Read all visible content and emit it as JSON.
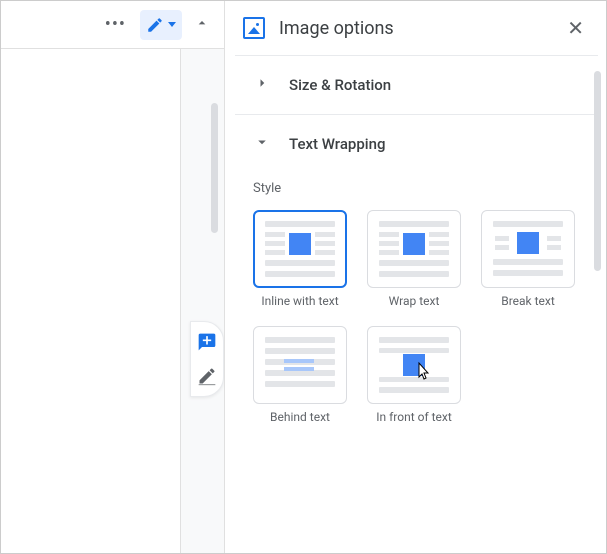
{
  "panel": {
    "title": "Image options",
    "sections": {
      "size_rotation": "Size & Rotation",
      "text_wrapping": "Text Wrapping"
    },
    "style_label": "Style",
    "wrap_options": {
      "inline": "Inline with text",
      "wrap": "Wrap text",
      "break": "Break text",
      "behind": "Behind text",
      "front": "In front of text"
    }
  }
}
